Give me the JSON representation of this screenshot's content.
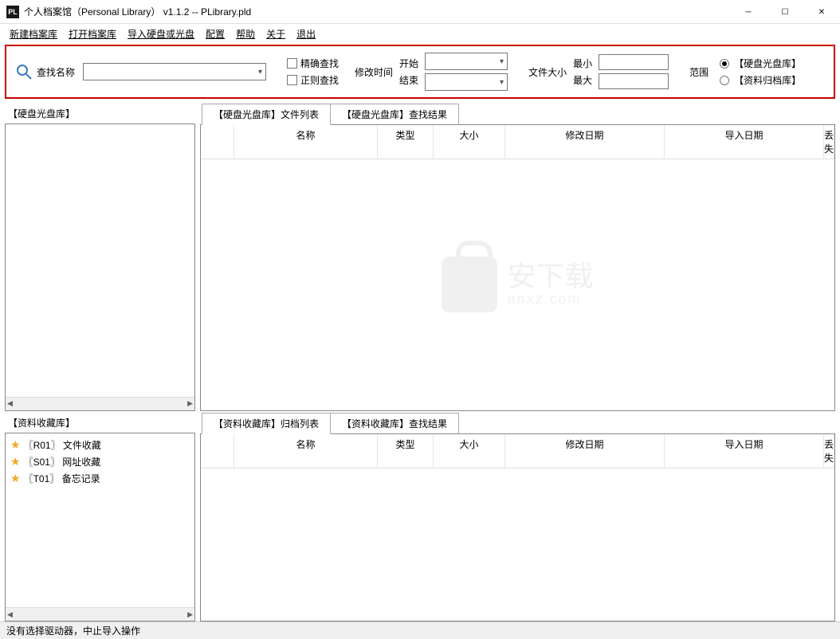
{
  "title": "个人档案馆（Personal Library） v1.1.2 -- PLibrary.pld",
  "app_icon_text": "PL",
  "menu": {
    "new": "新建档案库",
    "open": "打开档案库",
    "import": "导入硬盘或光盘",
    "config": "配置",
    "help": "帮助",
    "about": "关于",
    "exit": "退出"
  },
  "search": {
    "label": "查找名称",
    "exact": "精确查找",
    "regex": "正则查找",
    "mod_time": "修改时间",
    "start": "开始",
    "end": "结束",
    "file_size": "文件大小",
    "min": "最小",
    "max": "最大",
    "range": "范围",
    "radio_disk": "【硬盘光盘库】",
    "radio_archive": "【资料归档库】"
  },
  "panes": {
    "disk_title": "【硬盘光盘库】",
    "collect_title": "【资料收藏库】"
  },
  "tabs": {
    "disk_file_list": "【硬盘光盘库】文件列表",
    "disk_search": "【硬盘光盘库】查找结果",
    "collect_archive_list": "【资料收藏库】归档列表",
    "collect_search": "【资料收藏库】查找结果"
  },
  "columns": {
    "name": "名称",
    "type": "类型",
    "size": "大小",
    "mod_date": "修改日期",
    "import_date": "导入日期",
    "lost": "丢失"
  },
  "tree": [
    "〖R01〗 文件收藏",
    "〖S01〗 网址收藏",
    "〖T01〗 备忘记录"
  ],
  "watermark": {
    "main": "安下载",
    "sub": "anxz.com"
  },
  "status": "没有选择驱动器，中止导入操作"
}
